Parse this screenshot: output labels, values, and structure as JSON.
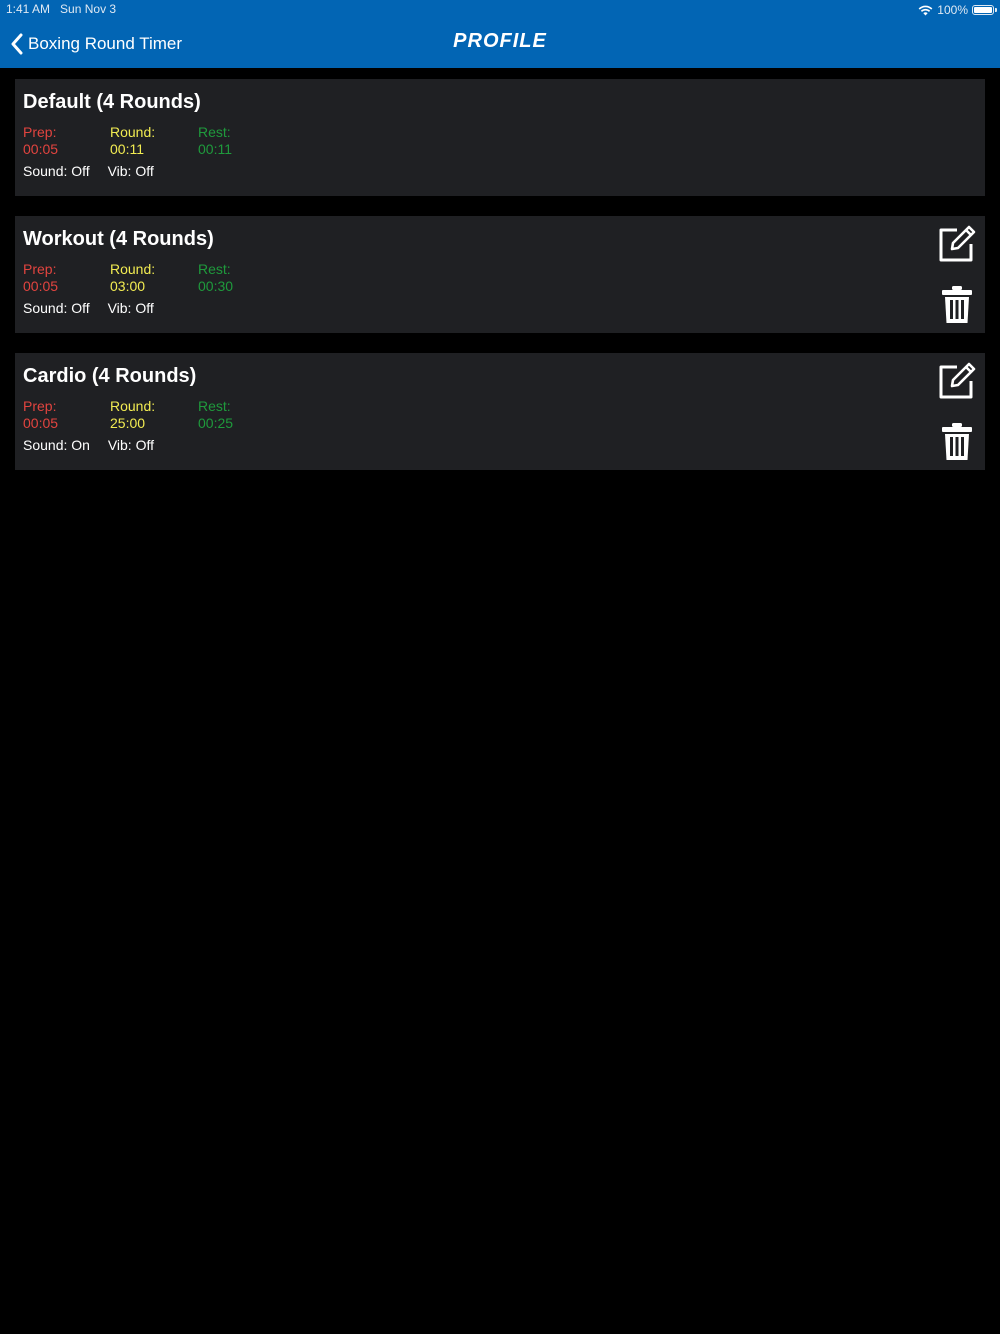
{
  "status_bar": {
    "time": "1:41 AM",
    "date": "Sun Nov 3",
    "battery": "100%"
  },
  "nav": {
    "back_label": "Boxing Round Timer",
    "title": "PROFILE"
  },
  "colors": {
    "header_bg": "#0265b4",
    "card_bg": "#1f2023",
    "prep": "#e2443f",
    "round": "#f2ec52",
    "rest": "#1f9a3c"
  },
  "icons": {
    "back": "chevron-left-icon",
    "edit": "edit-icon",
    "delete": "trash-icon"
  },
  "profiles": [
    {
      "title": "Default (4 Rounds)",
      "prep_label": "Prep:",
      "prep_value": "00:05",
      "round_label": "Round:",
      "round_value": "00:11",
      "rest_label": "Rest:",
      "rest_value": "00:11",
      "sound": "Sound: Off",
      "vib": "Vib: Off"
    },
    {
      "title": "Workout (4 Rounds)",
      "prep_label": "Prep:",
      "prep_value": "00:05",
      "round_label": "Round:",
      "round_value": "03:00",
      "rest_label": "Rest:",
      "rest_value": "00:30",
      "sound": "Sound: Off",
      "vib": "Vib: Off"
    },
    {
      "title": "Cardio (4 Rounds)",
      "prep_label": "Prep:",
      "prep_value": "00:05",
      "round_label": "Round:",
      "round_value": "25:00",
      "rest_label": "Rest:",
      "rest_value": "00:25",
      "sound": "Sound: On",
      "vib": "Vib: Off"
    }
  ]
}
